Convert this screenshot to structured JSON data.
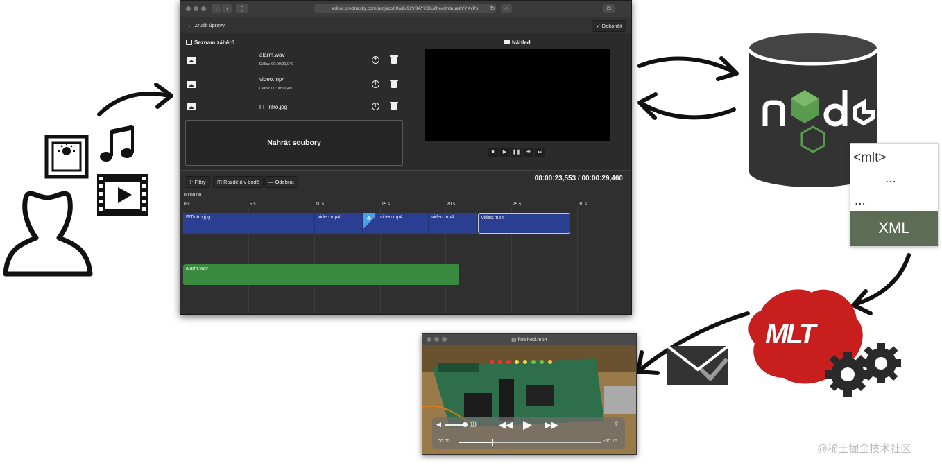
{
  "editor": {
    "url": "editor.prednasky.com/project/00w9x92V3AYGDu2hee3rrluuezVYXvPs",
    "toolbar": {
      "cancel_label": "← Zrušit úpravy",
      "done_label": "✓ Dokončit"
    },
    "clip_list": {
      "title": "Seznam záběrů",
      "items": [
        {
          "name": "alarm.wav",
          "duration": "Délka: 00:00:21,040"
        },
        {
          "name": "video.mp4",
          "duration": "Délka: 00:00:19,460"
        },
        {
          "name": "FITintro.jpg",
          "duration": ""
        }
      ],
      "upload_label": "Nahrát soubory"
    },
    "preview": {
      "title": "Náhled"
    },
    "timeline": {
      "buttons": [
        "Filtry",
        "Rozdělit v bodě",
        "Odebrat"
      ],
      "timecode": "00:00:23,553 / 00:00:29,460",
      "cursor_time": "00:00:00",
      "ticks": [
        "0 s",
        "5 s",
        "10 s",
        "15 s",
        "20 s",
        "25 s",
        "30 s"
      ],
      "video_track": [
        "FITintro.jpg",
        "video.mp4",
        "video.mp4",
        "video.mp4",
        "video.mp4"
      ],
      "audio_track": [
        "alarm.wav"
      ]
    }
  },
  "player": {
    "title": "finished.mp4",
    "elapsed": "00:05",
    "remaining": "-00:16",
    "progress_fraction": 0.238
  },
  "xml_doc": {
    "tag": "<mlt>",
    "ellipsis": "...",
    "label": "XML"
  },
  "mlt_logo": {
    "text": "MLT"
  },
  "watermark": "@稀土掘金技术社区",
  "colors": {
    "editor_bg": "#2b2b2b",
    "video_clip": "#2a3f91",
    "audio_clip": "#3a8a40",
    "playhead": "#d75a5a",
    "server_cylinder": "#333333",
    "node_green": "#5a9c4f",
    "xml_footer": "#5c6c55",
    "mlt_red": "#c81e1e"
  }
}
